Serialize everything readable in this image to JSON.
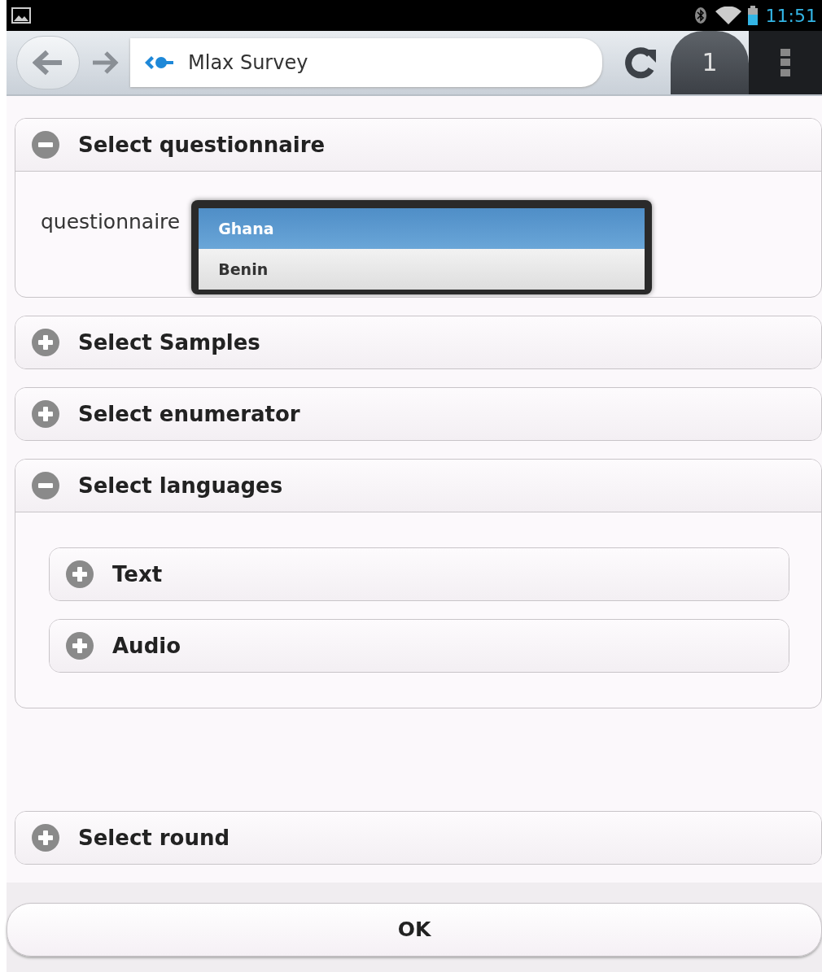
{
  "status_bar": {
    "time": "11:51"
  },
  "browser": {
    "page_title": "Mlax Survey",
    "tab_count": "1"
  },
  "sections": [
    {
      "title": "Select questionnaire",
      "expanded": true,
      "field_label": "questionnaire",
      "options": [
        {
          "label": "Ghana",
          "selected": true
        },
        {
          "label": "Benin",
          "selected": false
        }
      ]
    },
    {
      "title": "Select Samples",
      "expanded": false
    },
    {
      "title": "Select enumerator",
      "expanded": false
    },
    {
      "title": "Select languages",
      "expanded": true,
      "children": [
        {
          "title": "Text",
          "expanded": false
        },
        {
          "title": "Audio",
          "expanded": false
        }
      ]
    },
    {
      "title": "Select round",
      "expanded": false
    }
  ],
  "ok_button": "OK"
}
